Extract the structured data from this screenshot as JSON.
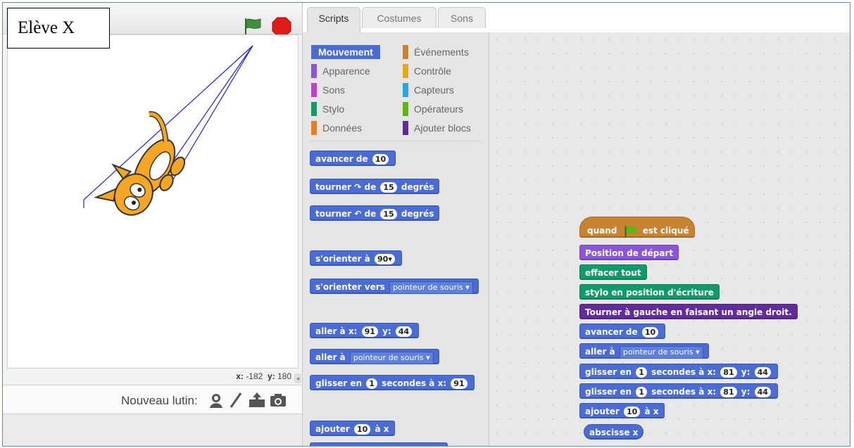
{
  "label": "Elève X",
  "stage": {
    "coords": {
      "x_label": "x:",
      "x_value": "-182",
      "y_label": "y:",
      "y_value": "180"
    },
    "new_sprite_label": "Nouveau lutin:"
  },
  "tabs": [
    "Scripts",
    "Costumes",
    "Sons"
  ],
  "categories": {
    "left": [
      "Mouvement",
      "Apparence",
      "Sons",
      "Stylo",
      "Données"
    ],
    "right": [
      "Événements",
      "Contrôle",
      "Capteurs",
      "Opérateurs",
      "Ajouter blocs"
    ]
  },
  "colors": {
    "motion": "#4a6cd4",
    "looks": "#8a55d7",
    "sound": "#bb42c3",
    "pen": "#0e9a6c",
    "data": "#ee7d16",
    "events": "#c88330",
    "control": "#e1a91a",
    "sensing": "#2ca5e2",
    "operators": "#5cb712",
    "more": "#632d99"
  },
  "palette": {
    "b1": {
      "t": "avancer de",
      "v": "10"
    },
    "b2": {
      "a": "tourner",
      "b": "de",
      "v": "15",
      "c": "degrés"
    },
    "b3": {
      "a": "tourner",
      "b": "de",
      "v": "15",
      "c": "degrés"
    },
    "b4": {
      "t": "s'orienter à",
      "v": "90"
    },
    "b5": {
      "t": "s'orienter vers",
      "dd": "pointeur de souris"
    },
    "b6": {
      "a": "aller à x:",
      "x": "91",
      "b": "y:",
      "y": "44"
    },
    "b7": {
      "t": "aller à",
      "dd": "pointeur de souris"
    },
    "b8": {
      "a": "glisser en",
      "n": "1",
      "b": "secondes à x:",
      "x": "91"
    },
    "b9": {
      "a": "ajouter",
      "v": "10",
      "b": "à x"
    }
  },
  "script": {
    "s1": {
      "a": "quand",
      "b": "est cliqué"
    },
    "s2": "Position de départ",
    "s3": "effacer tout",
    "s4": "stylo en position d'écriture",
    "s5": "Tourner à gauche en faisant un angle droit.",
    "s6": {
      "t": "avancer de",
      "v": "10"
    },
    "s7": {
      "t": "aller à",
      "dd": "pointeur de souris"
    },
    "s8": {
      "a": "glisser en",
      "n": "1",
      "b": "secondes à x:",
      "x": "81",
      "c": "y:",
      "y": "44"
    },
    "s9": {
      "a": "glisser en",
      "n": "1",
      "b": "secondes à x:",
      "x": "81",
      "c": "y:",
      "y": "44"
    },
    "s10": {
      "a": "ajouter",
      "v": "10",
      "b": "à x"
    },
    "s11": "abscisse x"
  }
}
